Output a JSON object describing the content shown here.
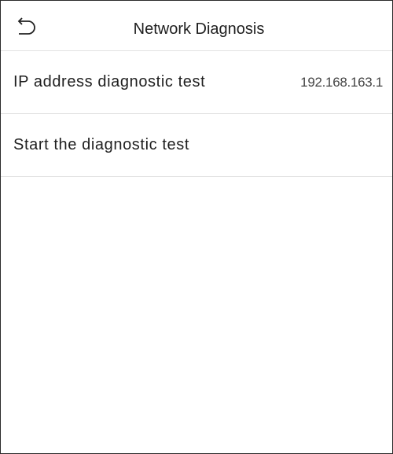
{
  "header": {
    "title": "Network Diagnosis",
    "back_icon": "back-arrow-icon"
  },
  "items": [
    {
      "label": "IP address diagnostic test",
      "value": "192.168.163.1"
    },
    {
      "label": "Start the diagnostic test"
    }
  ]
}
